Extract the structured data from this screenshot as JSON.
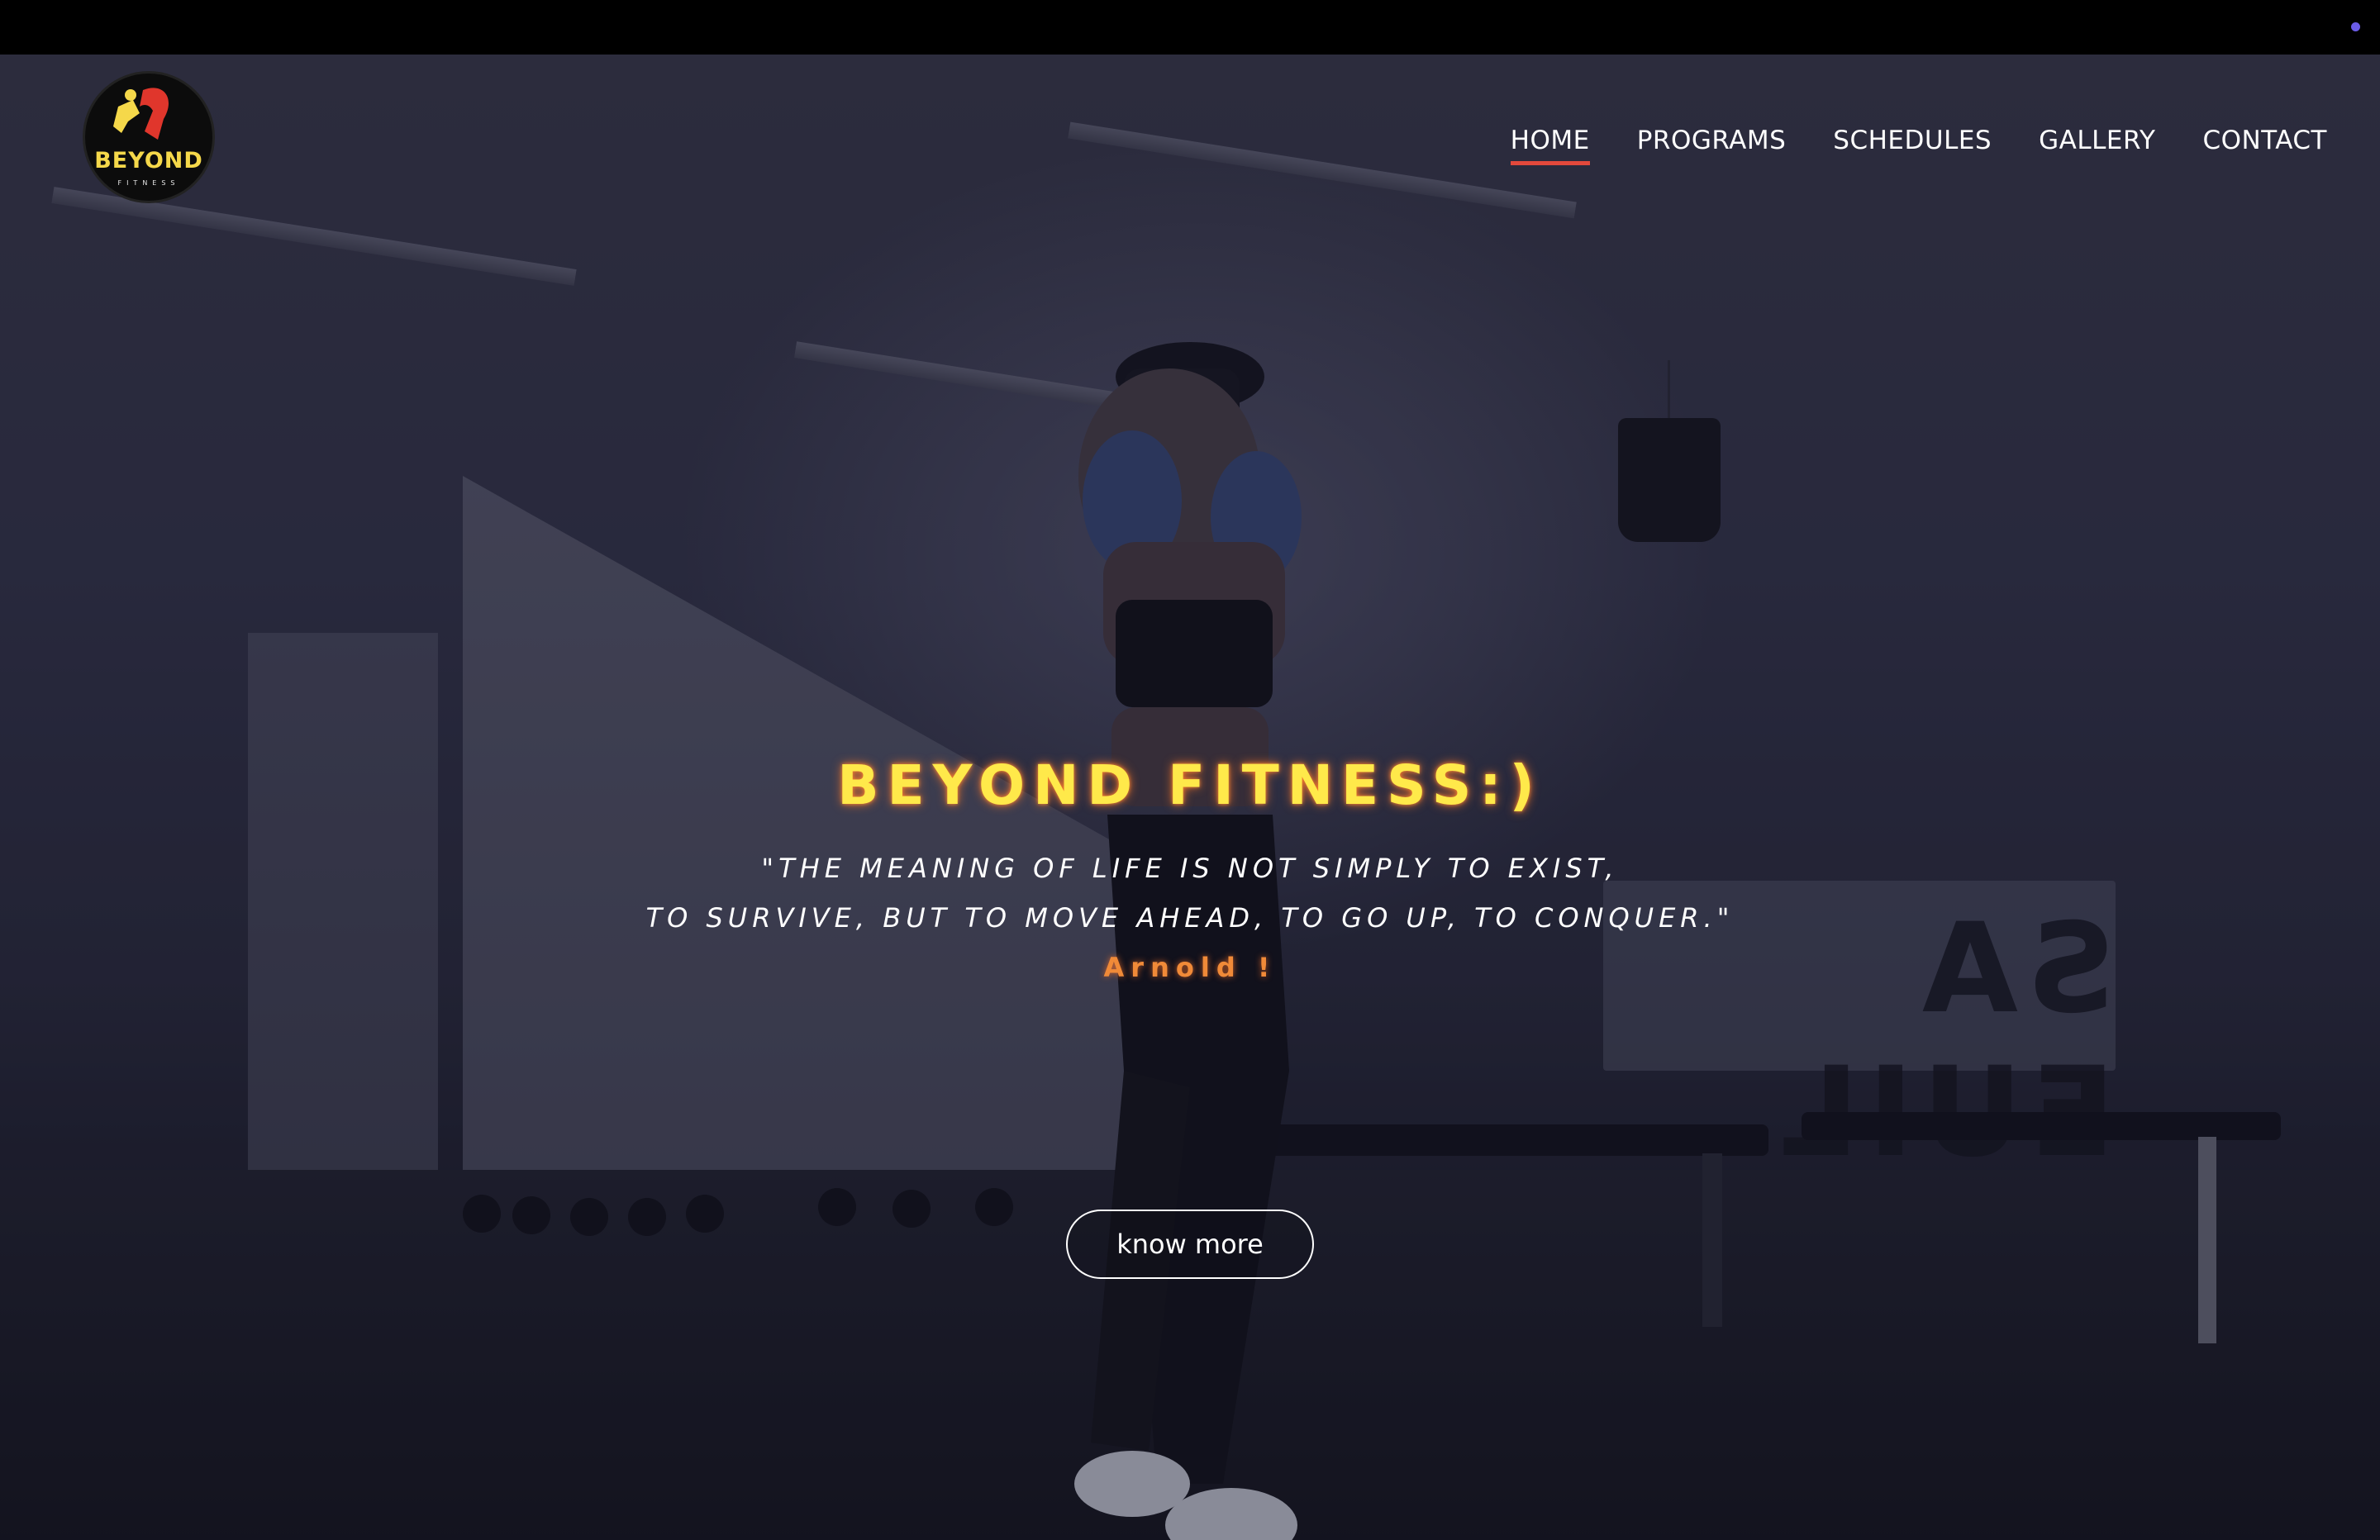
{
  "brand": {
    "logo_word": "BEYOND",
    "logo_sub": "FITNESS",
    "logo_icon": "boxer-silhouette-icon",
    "accent_yellow": "#ffe94a",
    "accent_red": "#e3493c",
    "accent_orange": "#f08a38"
  },
  "nav": {
    "items": [
      {
        "label": "HOME",
        "active": true
      },
      {
        "label": "PROGRAMS",
        "active": false
      },
      {
        "label": "SCHEDULES",
        "active": false
      },
      {
        "label": "GALLERY",
        "active": false
      },
      {
        "label": "CONTACT",
        "active": false
      }
    ]
  },
  "hero": {
    "headline": "BEYOND FITNESS:)",
    "quote_line_1": "\"THE MEANING OF LIFE IS NOT SIMPLY TO EXIST,",
    "quote_line_2": "TO SURVIVE, BUT TO MOVE AHEAD, TO GO UP, TO CONQUER.\"",
    "author": "Arnold !",
    "cta_label": "know more"
  }
}
